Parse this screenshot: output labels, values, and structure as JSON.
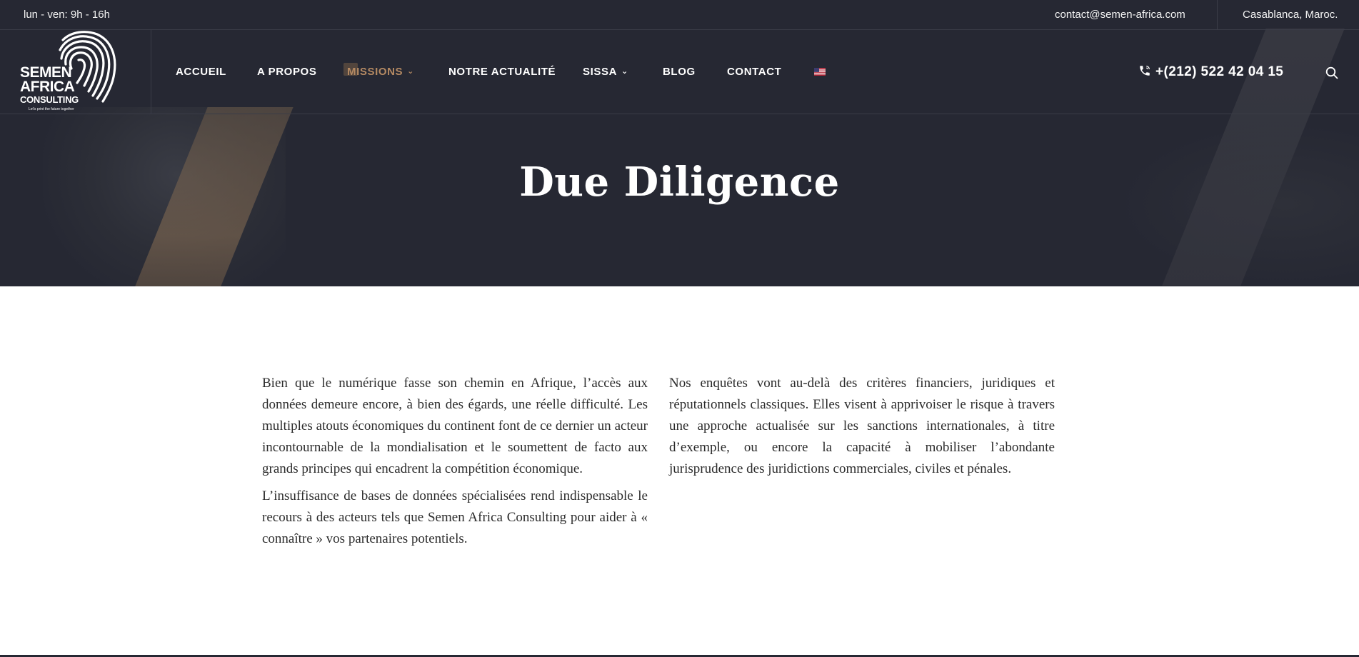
{
  "topbar": {
    "hours": "lun - ven: 9h - 16h",
    "email": "contact@semen-africa.com",
    "city": "Casablanca, Maroc."
  },
  "logo": {
    "line1": "SEMEN",
    "line2": "AFRICA",
    "line3": "CONSULTING",
    "tagline": "Let's print the future together"
  },
  "nav": {
    "items": [
      {
        "label": "ACCUEIL"
      },
      {
        "label": "A PROPOS"
      },
      {
        "label": "MISSIONS"
      },
      {
        "label": "NOTRE ACTUALITÉ"
      },
      {
        "label": "SISSA"
      },
      {
        "label": "BLOG"
      },
      {
        "label": "CONTACT"
      }
    ],
    "phone": "+(212) 522 42 04 15",
    "language_icon": "us-flag-icon"
  },
  "page": {
    "title": "Due Diligence"
  },
  "content": {
    "left_p1": "Bien que le numérique fasse son chemin en Afrique, l’accès aux données demeure encore, à bien des égards, une réelle difficulté. Les multiples atouts économiques du continent font de ce dernier un acteur incontournable de la mondialisation et le soumettent de facto aux grands principes qui encadrent la compétition économique.",
    "left_p2": "L’insuffisance de bases de données spécialisées rend indispensable le recours à des acteurs tels que Semen Africa Consulting pour aider à « connaître » vos partenaires potentiels.",
    "right_p1": "Nos enquêtes vont au-delà des critères financiers, juridiques et réputationnels classiques. Elles visent à apprivoiser le risque à travers une approche actualisée sur les sanctions internationales, à titre d’exemple, ou encore la capacité à mobiliser l’abondante jurisprudence des juridictions commerciales, civiles et pénales."
  },
  "colors": {
    "header_bg": "#262833",
    "accent": "#b58a63",
    "text": "#2b2b2b"
  }
}
